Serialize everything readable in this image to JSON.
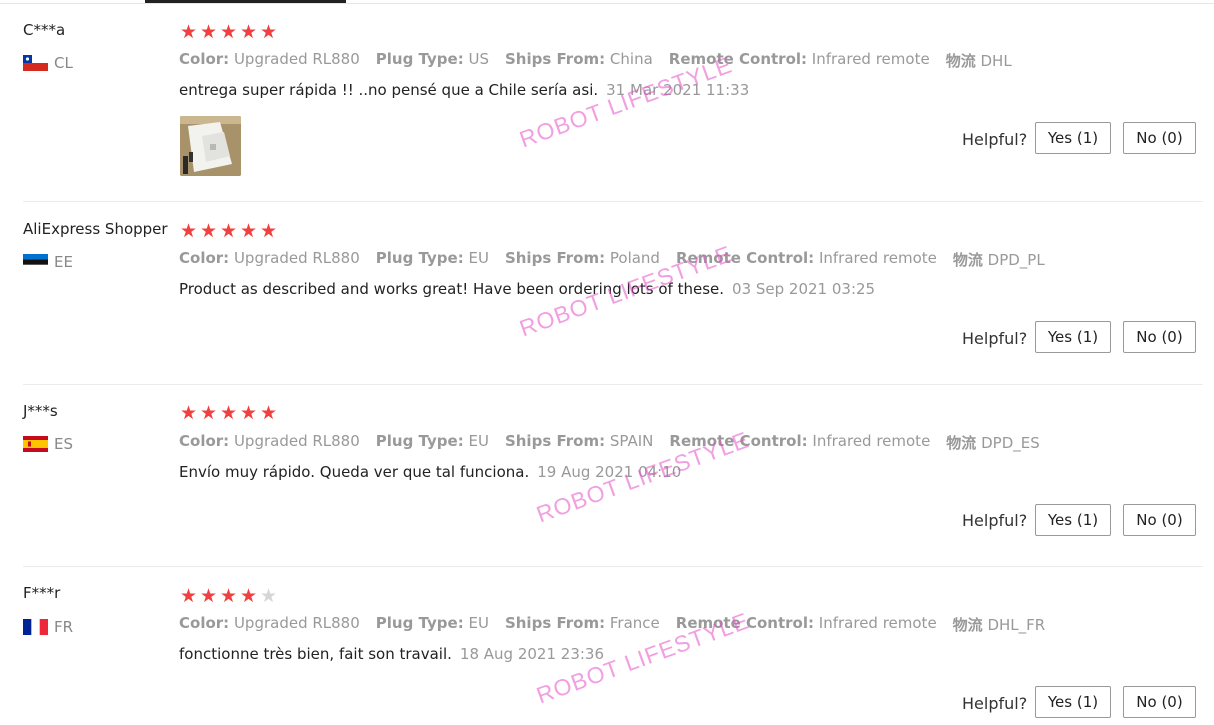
{
  "helpful_label": "Helpful?",
  "watermark": "ROBOT LIFESTYLE",
  "labels": {
    "color": "Color:",
    "plug": "Plug Type:",
    "ships": "Ships From:",
    "remote": "Remote Control:",
    "logistics": "物流"
  },
  "reviews": [
    {
      "name": "C***a",
      "country": "CL",
      "rating": 5,
      "color": "Upgraded RL880",
      "plug": "US",
      "ships": "China",
      "remote": "Infrared remote",
      "logistics": "DHL",
      "text": "entrega super rápida !! ..no pensé que a Chile sería asi.",
      "date": "31 Mar 2021 11:33",
      "yes": "Yes (1)",
      "no": "No (0)",
      "has_photo": true
    },
    {
      "name": "AliExpress Shopper",
      "country": "EE",
      "rating": 5,
      "color": "Upgraded RL880",
      "plug": "EU",
      "ships": "Poland",
      "remote": "Infrared remote",
      "logistics": "DPD_PL",
      "text": "Product as described and works great! Have been ordering lots of these.",
      "date": "03 Sep 2021 03:25",
      "yes": "Yes (1)",
      "no": "No (0)"
    },
    {
      "name": "J***s",
      "country": "ES",
      "rating": 5,
      "color": "Upgraded RL880",
      "plug": "EU",
      "ships": "SPAIN",
      "remote": "Infrared remote",
      "logistics": "DPD_ES",
      "text": "Envío muy rápido. Queda ver que tal funciona.",
      "date": "19 Aug 2021 04:10",
      "yes": "Yes (1)",
      "no": "No (0)"
    },
    {
      "name": "F***r",
      "country": "FR",
      "rating": 4,
      "color": "Upgraded RL880",
      "plug": "EU",
      "ships": "France",
      "remote": "Infrared remote",
      "logistics": "DHL_FR",
      "text": "fonctionne très bien, fait son travail.",
      "date": "18 Aug 2021 23:36",
      "yes": "Yes (1)",
      "no": "No (0)"
    }
  ]
}
